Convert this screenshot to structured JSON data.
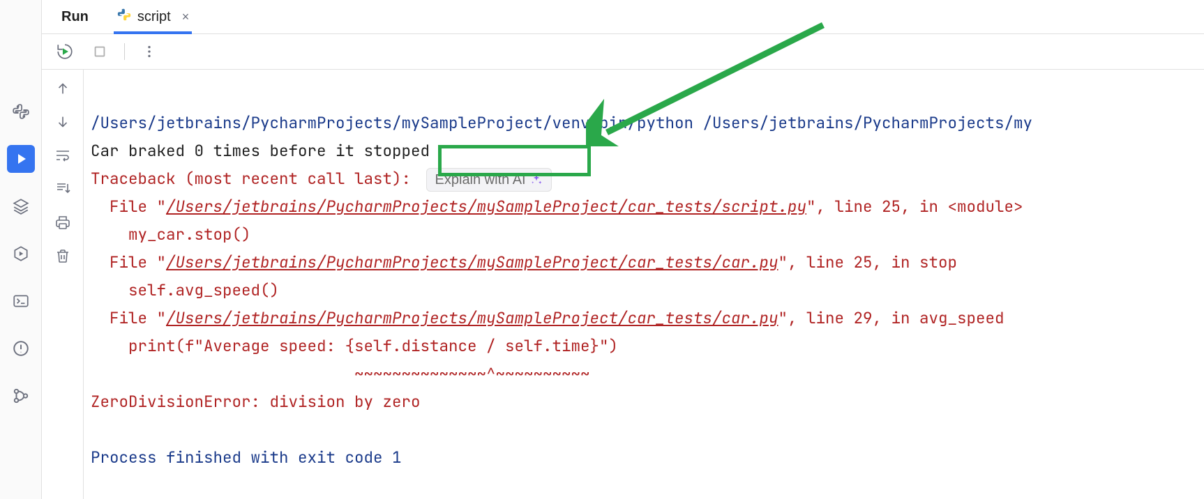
{
  "tabs": {
    "run_label": "Run",
    "script_label": "script"
  },
  "explain_button": "Explain with AI",
  "console": {
    "line1_a": "/Users/jetbrains/PycharmProjects/mySampleProject/venv/bin/python",
    "line1_b": " /Users/jetbrains/PycharmProjects/my",
    "line2": "Car braked 0 times before it stopped",
    "traceback": "Traceback (most recent call last):",
    "file_prefix": "  File \"",
    "link1": "/Users/jetbrains/PycharmProjects/mySampleProject/car_tests/script.py",
    "loc1": "\", line 25, in <module>",
    "call1": "    my_car.stop()",
    "link2": "/Users/jetbrains/PycharmProjects/mySampleProject/car_tests/car.py",
    "loc2": "\", line 25, in stop",
    "call2": "    self.avg_speed()",
    "link3": "/Users/jetbrains/PycharmProjects/mySampleProject/car_tests/car.py",
    "loc3": "\", line 29, in avg_speed",
    "call3": "    print(f\"Average speed: {self.distance / self.time}\")",
    "tildes": "                            ~~~~~~~~~~~~~~^~~~~~~~~~~",
    "error": "ZeroDivisionError: division by zero",
    "blank": "",
    "exit": "Process finished with exit code 1"
  }
}
